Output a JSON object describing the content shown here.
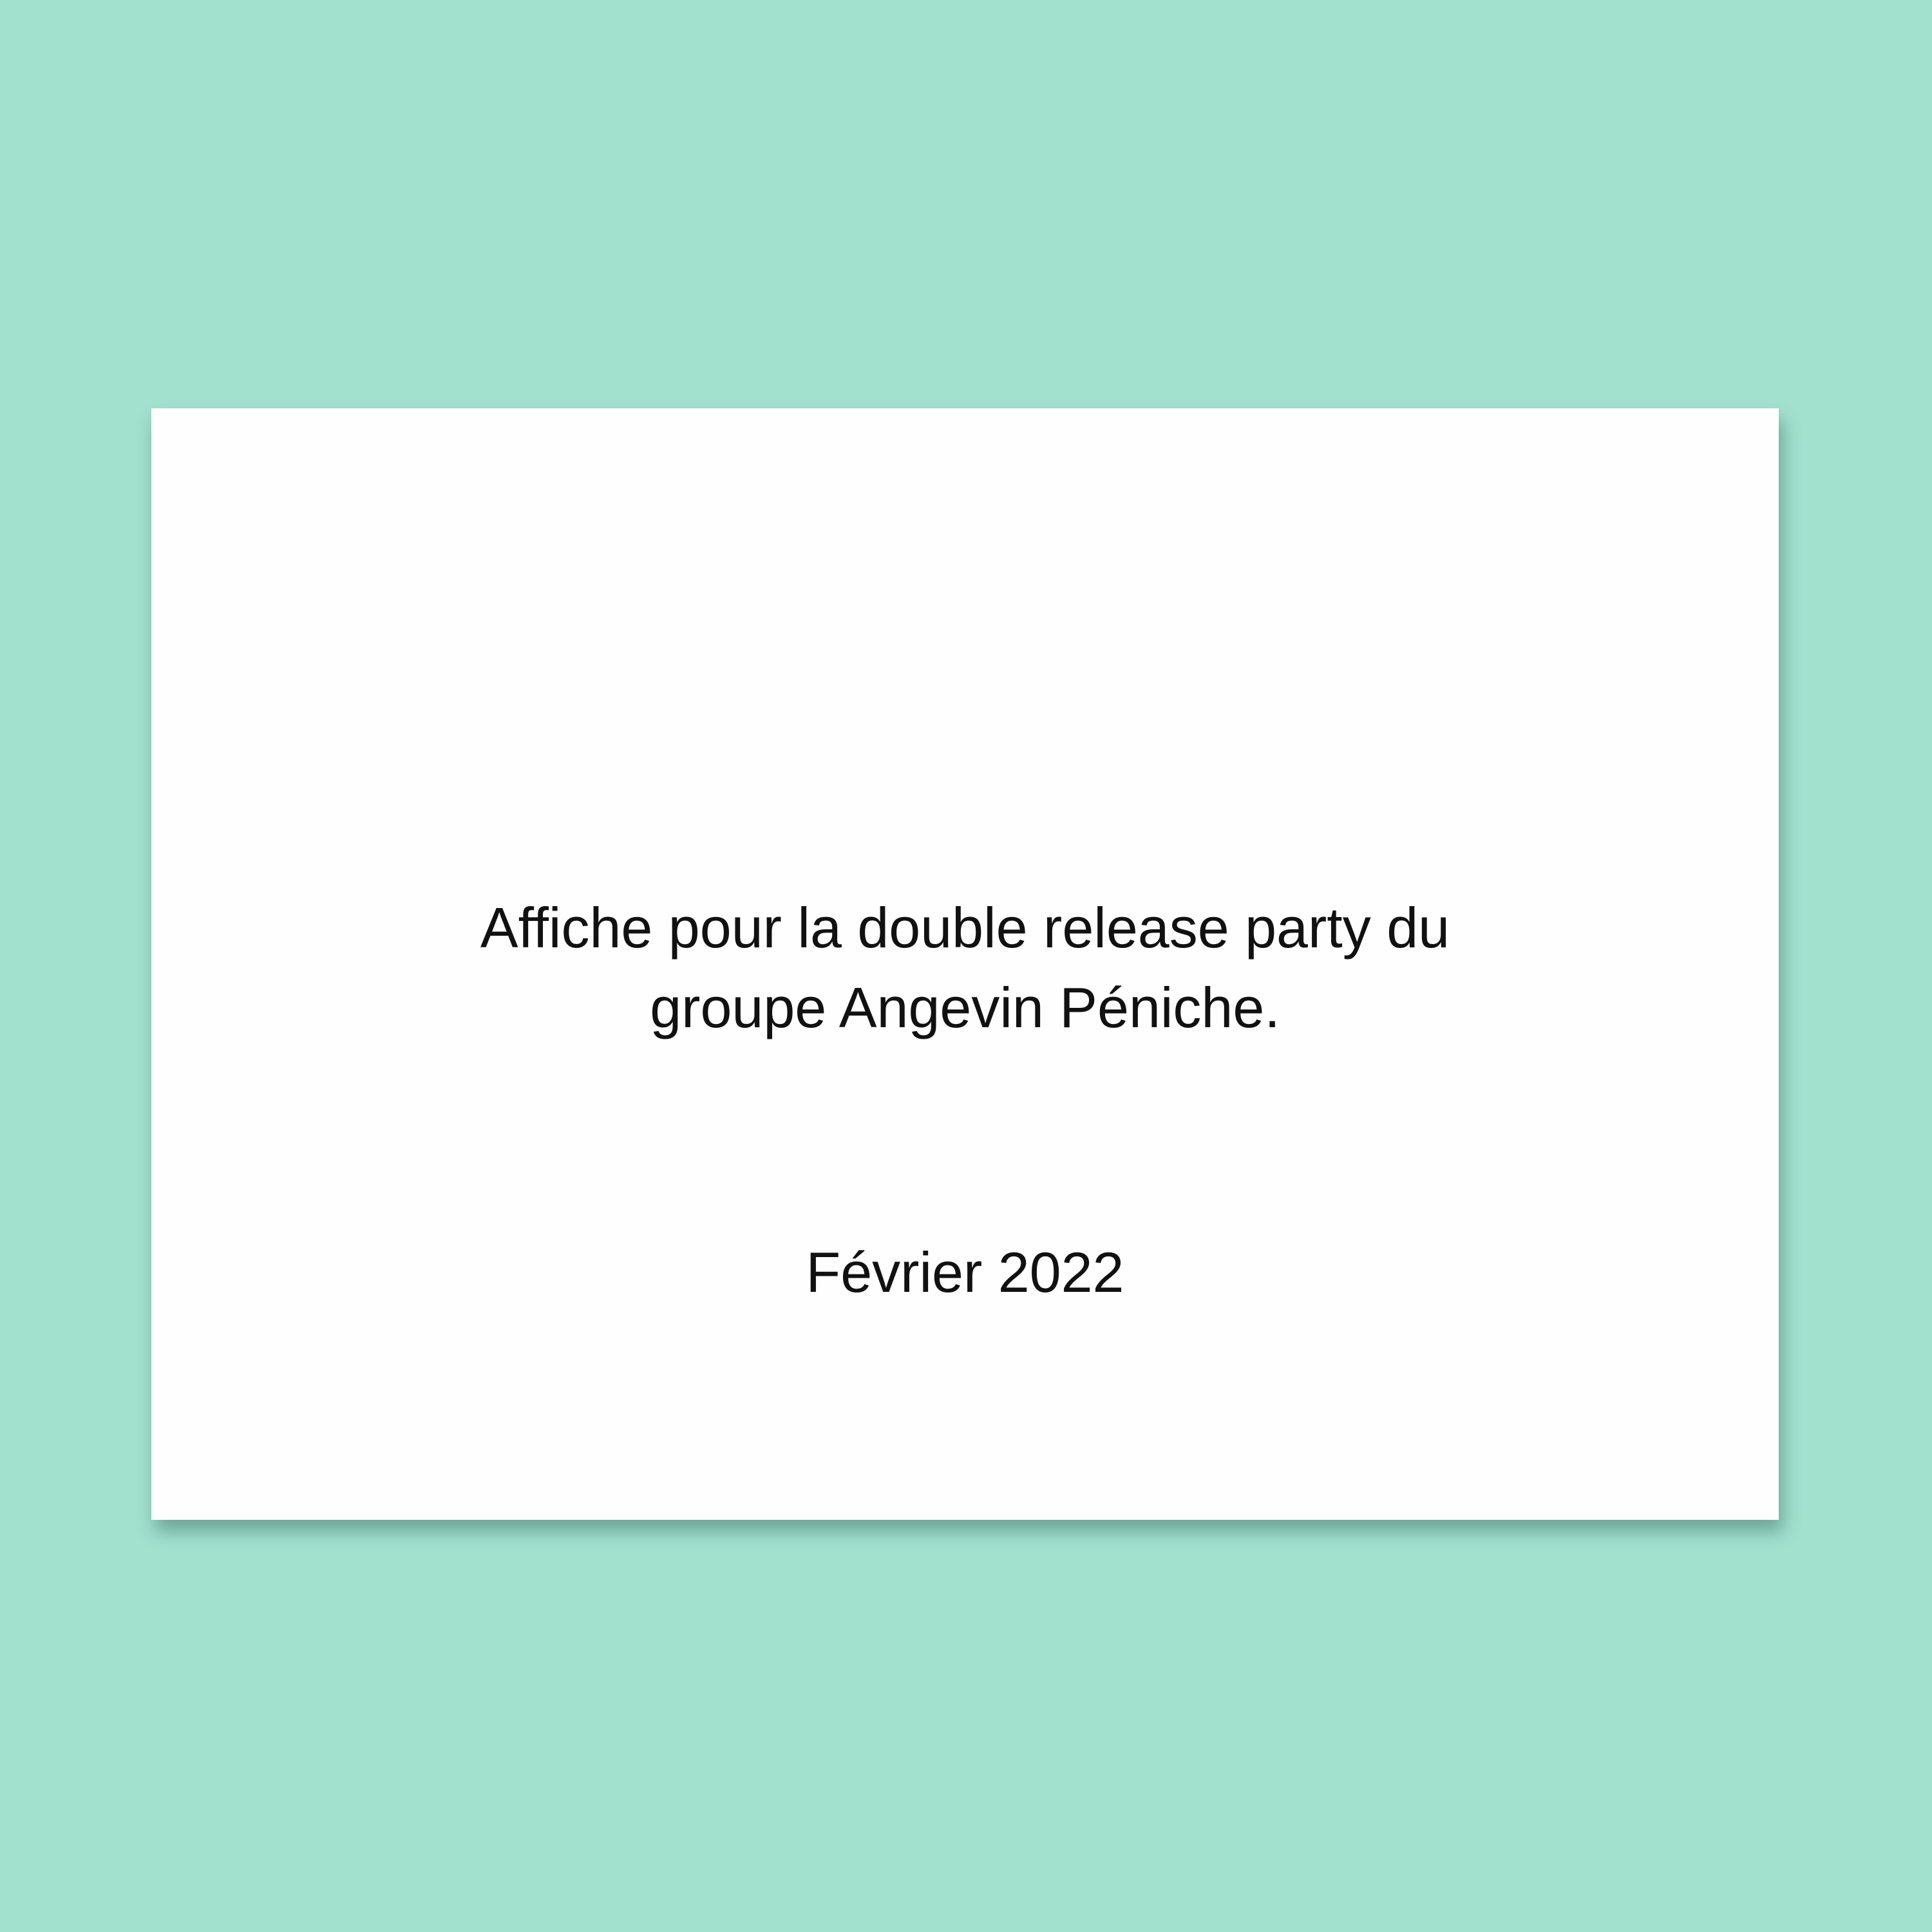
{
  "card": {
    "description_lines": [
      "Affiche pour la double release party du",
      "groupe Angevin Péniche."
    ],
    "date": "Février 2022"
  },
  "colors": {
    "background": "#a3e1cf",
    "card": "#fefefe",
    "text": "#111111"
  }
}
